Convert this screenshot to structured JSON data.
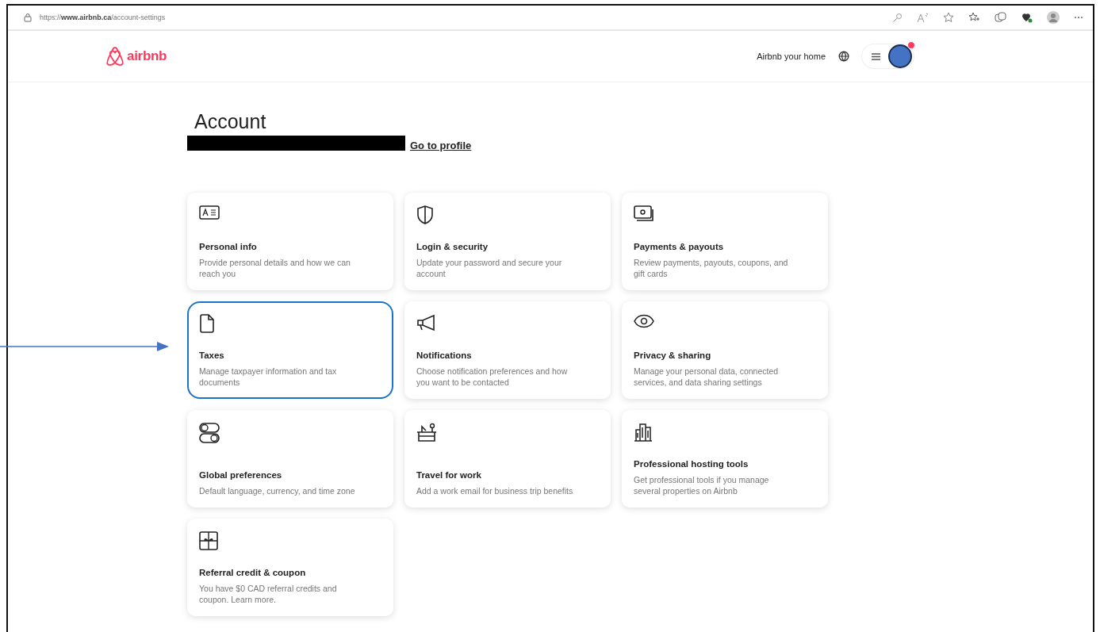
{
  "browser": {
    "url_prefix": "https://",
    "url_host": "www.airbnb.ca",
    "url_path": "/account-settings"
  },
  "header": {
    "logo": "airbnb",
    "host_link": "Airbnb your home",
    "notification_dot": true
  },
  "page": {
    "title": "Account",
    "profile_link": "Go to profile"
  },
  "cards": [
    {
      "title": "Personal info",
      "description": "Provide personal details and how we can reach you",
      "selected": false
    },
    {
      "title": "Login & security",
      "description": "Update your password and secure your account",
      "selected": false
    },
    {
      "title": "Payments & payouts",
      "description": "Review payments, payouts, coupons, and gift cards",
      "selected": false
    },
    {
      "title": "Taxes",
      "description": "Manage taxpayer information and tax documents",
      "selected": true
    },
    {
      "title": "Notifications",
      "description": "Choose notification preferences and how you want to be contacted",
      "selected": false
    },
    {
      "title": "Privacy & sharing",
      "description": "Manage your personal data, connected services, and data sharing settings",
      "selected": false
    },
    {
      "title": "Global preferences",
      "description": "Default language, currency, and time zone",
      "selected": false
    },
    {
      "title": "Travel for work",
      "description": "Add a work email for business trip benefits",
      "selected": false
    },
    {
      "title": "Professional hosting tools",
      "description": "Get professional tools if you manage several properties on Airbnb",
      "selected": false
    },
    {
      "title": "Referral credit & coupon",
      "description": "You have $0 CAD referral credits and coupon. Learn more.",
      "selected": false
    }
  ]
}
